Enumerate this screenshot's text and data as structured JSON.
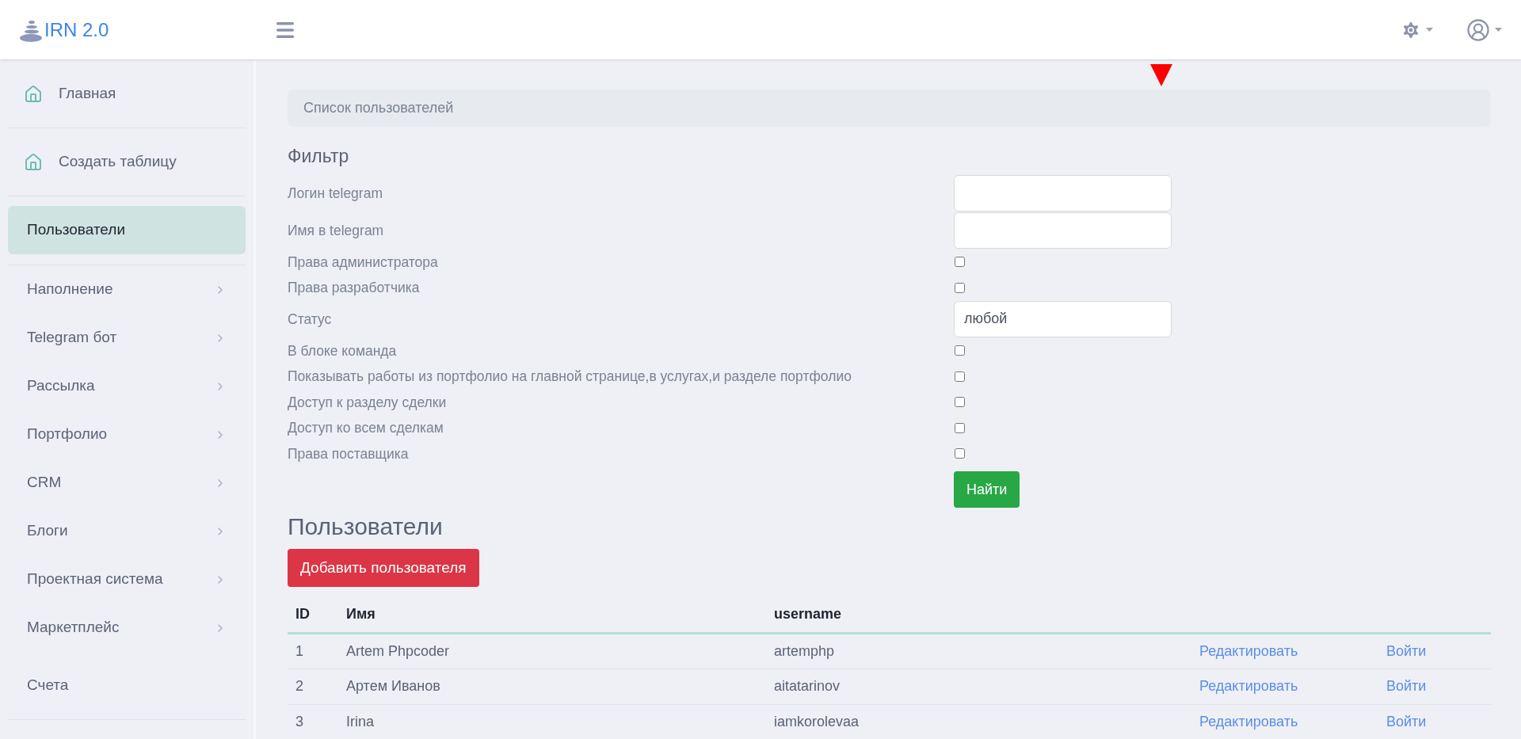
{
  "header": {
    "logo_text": "IRN 2.0"
  },
  "sidebar": {
    "items": [
      {
        "label": "Главная",
        "kind": "home",
        "selected": false
      },
      {
        "label": "Создать таблицу",
        "kind": "home",
        "selected": false
      },
      {
        "label": "Пользователи",
        "kind": "plain",
        "selected": true
      },
      {
        "label": "Наполнение",
        "kind": "submenu",
        "selected": false
      },
      {
        "label": "Telegram бот",
        "kind": "submenu",
        "selected": false
      },
      {
        "label": "Рассылка",
        "kind": "submenu",
        "selected": false
      },
      {
        "label": "Портфолио",
        "kind": "submenu",
        "selected": false
      },
      {
        "label": "CRM",
        "kind": "submenu",
        "selected": false
      },
      {
        "label": "Блоги",
        "kind": "submenu",
        "selected": false
      },
      {
        "label": "Проектная система",
        "kind": "submenu",
        "selected": false
      },
      {
        "label": "Маркетплейс",
        "kind": "submenu",
        "selected": false
      },
      {
        "label": "Счета",
        "kind": "plain",
        "selected": false
      }
    ]
  },
  "breadcrumb": "Список пользователей",
  "filter": {
    "title": "Фильтр",
    "fields": [
      {
        "label": "Логин telegram",
        "kind": "text"
      },
      {
        "label": "Имя в telegram",
        "kind": "text"
      },
      {
        "label": "Права администратора",
        "kind": "checkbox",
        "checked": false
      },
      {
        "label": "Права разработчика",
        "kind": "checkbox",
        "checked": false
      },
      {
        "label": "Статус",
        "kind": "select",
        "value": "любой"
      },
      {
        "label": "В блоке команда",
        "kind": "checkbox",
        "checked": false
      },
      {
        "label": "Показывать работы из портфолио на главной странице,в услугах,и разделе портфолио",
        "kind": "checkbox",
        "checked": false
      },
      {
        "label": "Доступ к разделу сделки",
        "kind": "checkbox",
        "checked": false
      },
      {
        "label": "Доступ ко всем сделкам",
        "kind": "checkbox",
        "checked": false
      },
      {
        "label": "Права поставщика",
        "kind": "checkbox",
        "checked": false
      }
    ],
    "submit": "Найти"
  },
  "users": {
    "title": "Пользователи",
    "add_button": "Добавить пользователя",
    "columns": [
      "ID",
      "Имя",
      "username"
    ],
    "rows": [
      {
        "id": "1",
        "name": "Artem Phpcoder",
        "username": "artemphp",
        "edit": "Редактировать",
        "login": "Войти"
      },
      {
        "id": "2",
        "name": "Артем Иванов",
        "username": "aitatarinov",
        "edit": "Редактировать",
        "login": "Войти"
      },
      {
        "id": "3",
        "name": "Irina",
        "username": "iamkorolevaa",
        "edit": "Редактировать",
        "login": "Войти"
      }
    ]
  }
}
